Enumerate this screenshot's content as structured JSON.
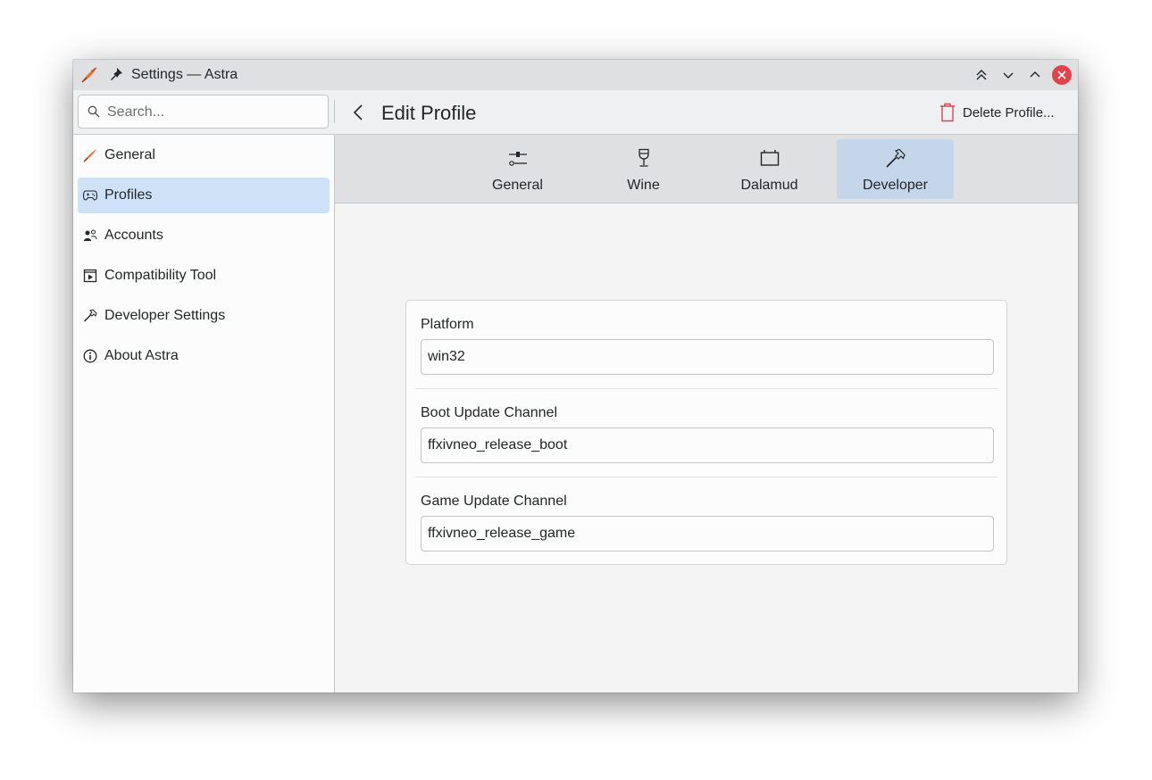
{
  "window": {
    "title": "Settings — Astra"
  },
  "search": {
    "placeholder": "Search..."
  },
  "header": {
    "title": "Edit Profile",
    "delete_label": "Delete Profile..."
  },
  "sidebar": {
    "items": [
      {
        "label": "General",
        "icon": "astra-quill-icon",
        "selected": false
      },
      {
        "label": "Profiles",
        "icon": "gamepad-icon",
        "selected": true
      },
      {
        "label": "Accounts",
        "icon": "users-icon",
        "selected": false
      },
      {
        "label": "Compatibility Tool",
        "icon": "play-box-icon",
        "selected": false
      },
      {
        "label": "Developer Settings",
        "icon": "hammer-icon",
        "selected": false
      },
      {
        "label": "About Astra",
        "icon": "info-icon",
        "selected": false
      }
    ]
  },
  "tabs": [
    {
      "label": "General",
      "icon": "sliders-icon",
      "selected": false
    },
    {
      "label": "Wine",
      "icon": "wine-glass-icon",
      "selected": false
    },
    {
      "label": "Dalamud",
      "icon": "window-icon",
      "selected": false
    },
    {
      "label": "Developer",
      "icon": "hammer-icon",
      "selected": true
    }
  ],
  "form": {
    "fields": [
      {
        "label": "Platform",
        "value": "win32"
      },
      {
        "label": "Boot Update Channel",
        "value": "ffxivneo_release_boot"
      },
      {
        "label": "Game Update Channel",
        "value": "ffxivneo_release_game"
      }
    ]
  },
  "colors": {
    "selection": "#cfe1f6",
    "tab_selection": "#c5d5ea",
    "close_button": "#e0434a",
    "delete_icon": "#da4453"
  }
}
